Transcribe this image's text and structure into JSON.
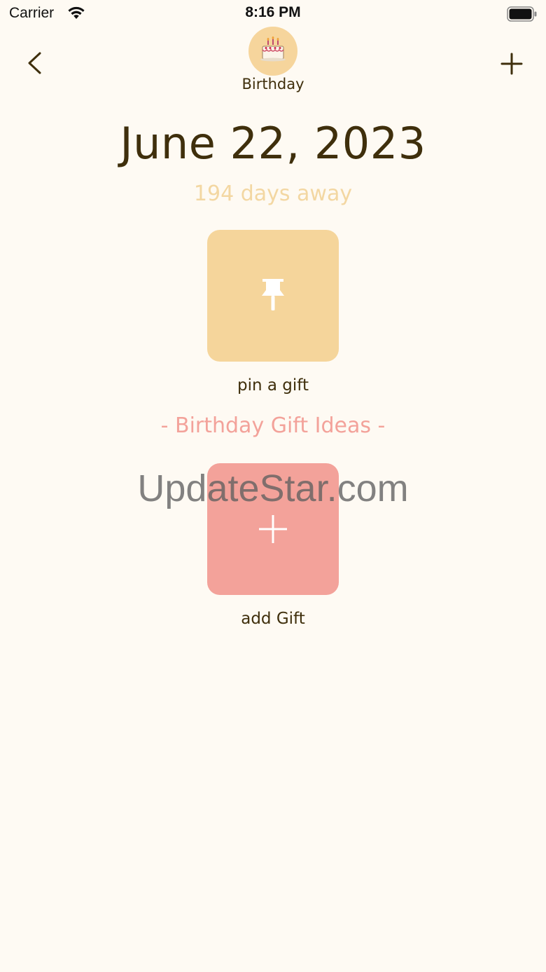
{
  "status_bar": {
    "carrier": "Carrier",
    "time": "8:16 PM",
    "wifi_icon": "wifi-icon",
    "battery_icon": "battery-full-icon"
  },
  "nav": {
    "back_icon": "chevron-left-icon",
    "add_icon": "plus-icon"
  },
  "event": {
    "icon": "🎂",
    "name": "Birthday",
    "date": "June 22, 2023",
    "days_away": "194 days away"
  },
  "pin": {
    "icon": "pushpin-icon",
    "label": "pin a gift"
  },
  "ideas": {
    "heading": "- Birthday Gift Ideas -"
  },
  "add_gift": {
    "icon": "plus-icon",
    "label": "add Gift"
  },
  "watermark": {
    "text": "UpdateStar.com"
  },
  "colors": {
    "background": "#fefaf3",
    "text_dark": "#3f2f0c",
    "accent_yellow": "#f5d59b",
    "days_away": "#f3d7a2",
    "accent_pink": "#f3a29a"
  }
}
